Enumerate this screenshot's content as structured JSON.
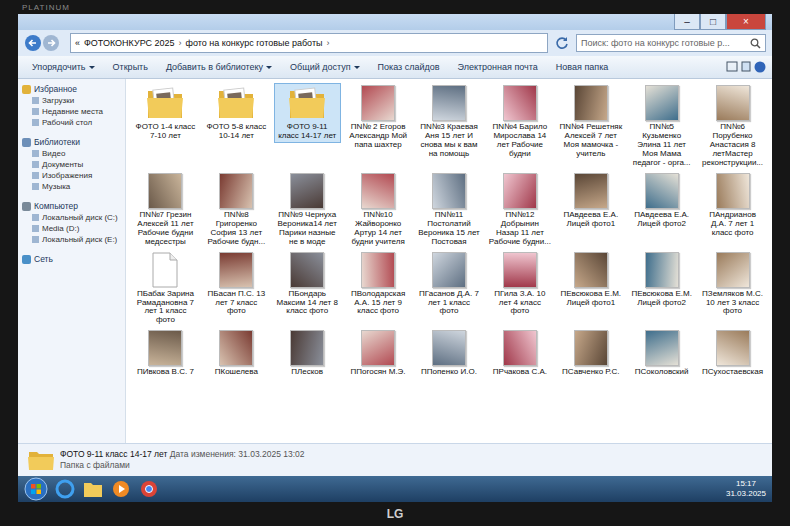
{
  "monitor": {
    "brand": "PLATINUM",
    "logo": "LG"
  },
  "window": {
    "controls": [
      "–",
      "□",
      "×"
    ]
  },
  "address": {
    "prefix": "«",
    "separator": "›",
    "crumbs": [
      "ФОТОКОНКУРС 2025",
      "фото на конкурс готовые работы"
    ]
  },
  "search": {
    "placeholder": "Поиск: фото на конкурс готовые р..."
  },
  "toolbar": [
    {
      "label": "Упорядочить",
      "menu": true
    },
    {
      "label": "Открыть",
      "menu": false
    },
    {
      "label": "Добавить в библиотеку",
      "menu": true
    },
    {
      "label": "Общий доступ",
      "menu": true
    },
    {
      "label": "Показ слайдов",
      "menu": false
    },
    {
      "label": "Электронная почта",
      "menu": false
    },
    {
      "label": "Новая папка",
      "menu": false
    }
  ],
  "sidebar": [
    {
      "header": "Избранное",
      "items": [
        "Загрузки",
        "Недавние места",
        "Рабочий стол"
      ]
    },
    {
      "header": "Библиотеки",
      "items": [
        "Видео",
        "Документы",
        "Изображения",
        "Музыка"
      ]
    },
    {
      "header": "Компьютер",
      "items": [
        "Локальный диск (C:)",
        "Media (D:)",
        "Локальный диск (E:)"
      ]
    },
    {
      "header": "Сеть",
      "items": []
    }
  ],
  "files": [
    {
      "name": "ФОТО 1-4 класс 7-10 лет",
      "kind": "folder",
      "selected": false
    },
    {
      "name": "ФОТО 5-8 класс 10-14 лет",
      "kind": "folder",
      "selected": false
    },
    {
      "name": "ФОТО 9-11 класс 14-17 лет",
      "kind": "folder",
      "selected": true
    },
    {
      "name": "ПN№ 2 Егоров Александр Мой папа шахтер",
      "kind": "photo",
      "selected": false
    },
    {
      "name": "ПN№3 Краевая Аня 15 лет И снова мы к вам на помощь",
      "kind": "photo",
      "selected": false
    },
    {
      "name": "ПN№4 Барило Мирослава 14 лет Рабочие будни",
      "kind": "photo",
      "selected": false
    },
    {
      "name": "ПN№4 Решетняк Алексей 7 лет Моя мамочка - учитель",
      "kind": "photo",
      "selected": false
    },
    {
      "name": "ПN№5 Кузьменко Элина 11 лет Моя Мама педагог - орга...",
      "kind": "photo",
      "selected": false
    },
    {
      "name": "ПN№6 Порубенко Анастасия 8 летМастер реконструкции...",
      "kind": "photo",
      "selected": false
    },
    {
      "name": "ПN№7 Грезин Алексей 11 лет Рабочие будни медсестры",
      "kind": "photo",
      "selected": false
    },
    {
      "name": "ПN№8 Григоренко София 13 лет Рабочие будн...",
      "kind": "photo",
      "selected": false
    },
    {
      "name": "ПN№9 Чернуха Вероника14 лет Парики назные не в моде",
      "kind": "photo",
      "selected": false
    },
    {
      "name": "ПN№10 Жайворонко Артур 14 лет будни учителя",
      "kind": "photo",
      "selected": false
    },
    {
      "name": "ПN№11 Постолатий Вероника 15 лет Постовая",
      "kind": "photo",
      "selected": false
    },
    {
      "name": "ПN№12 Добрынин Назар 11 лет Рабочие будни...",
      "kind": "photo",
      "selected": false
    },
    {
      "name": "ПАвдеева Е.А. Лицей фото1",
      "kind": "photo",
      "selected": false
    },
    {
      "name": "ПАвдеева Е.А. Лицей фото2",
      "kind": "photo",
      "selected": false
    },
    {
      "name": "ПАндрианов Д.А. 7 лет 1 класс фото",
      "kind": "photo",
      "selected": false
    },
    {
      "name": "ПБабак Зарина Рамадановна 7 лет 1 класс фото",
      "kind": "file",
      "selected": false
    },
    {
      "name": "ПБасан П.С. 13 лет 7 класс фото",
      "kind": "photo",
      "selected": false
    },
    {
      "name": "ПБондарь Максим 14 лет 8 класс фото",
      "kind": "photo",
      "selected": false
    },
    {
      "name": "ПВолодарская А.А. 15 лет 9 класс фото",
      "kind": "photo",
      "selected": false
    },
    {
      "name": "ПГасанов Д.А. 7 лет 1 класс фото",
      "kind": "photo",
      "selected": false
    },
    {
      "name": "ПГила З.А. 10 лет 4 класс фото",
      "kind": "photo",
      "selected": false
    },
    {
      "name": "ПЕвсюкова Е.М. Лицей фото1",
      "kind": "photo",
      "selected": false
    },
    {
      "name": "ПЕвсюкова Е.М. Лицей фото2",
      "kind": "photo",
      "selected": false
    },
    {
      "name": "ПЗемляков М.С. 10 лет 3 класс фото",
      "kind": "photo",
      "selected": false
    },
    {
      "name": "ПИвкова В.С. 7",
      "kind": "photo",
      "selected": false
    },
    {
      "name": "ПКошелева",
      "kind": "photo",
      "selected": false
    },
    {
      "name": "ПЛесков",
      "kind": "photo",
      "selected": false
    },
    {
      "name": "ППогосян М.Э.",
      "kind": "photo",
      "selected": false
    },
    {
      "name": "ППопенко И.О.",
      "kind": "photo",
      "selected": false
    },
    {
      "name": "ПРчакова С.А.",
      "kind": "photo",
      "selected": false
    },
    {
      "name": "ПСавченко Р.С.",
      "kind": "photo",
      "selected": false
    },
    {
      "name": "ПСоколовский",
      "kind": "photo",
      "selected": false
    },
    {
      "name": "ПСухостаевская",
      "kind": "photo",
      "selected": false
    }
  ],
  "status": {
    "name": "ФОТО 9-11 класс 14-17 лет",
    "meta": "Дата изменения: 31.03.2025 13:02",
    "type": "Папка с файлами"
  },
  "taskbar": {
    "time": "15:17",
    "date": "31.03.2025"
  }
}
